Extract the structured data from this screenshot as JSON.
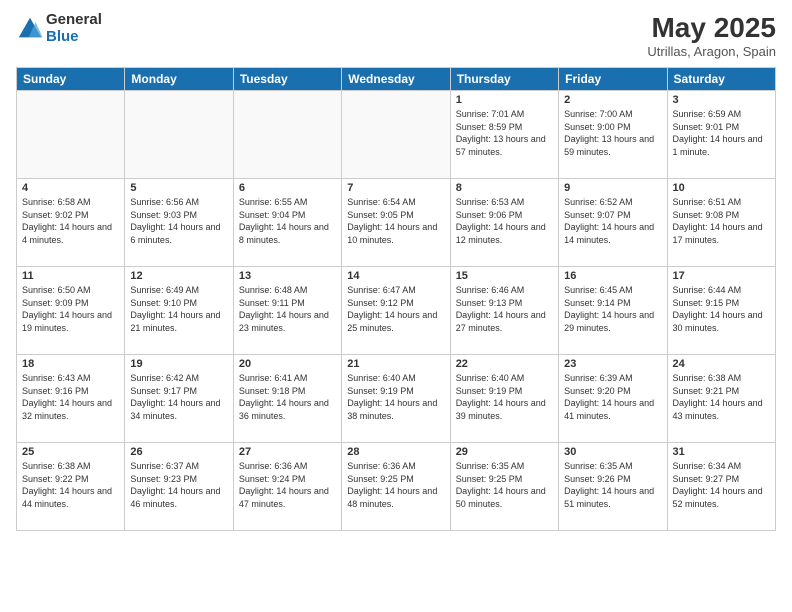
{
  "header": {
    "logo_general": "General",
    "logo_blue": "Blue",
    "month_title": "May 2025",
    "location": "Utrillas, Aragon, Spain"
  },
  "days_of_week": [
    "Sunday",
    "Monday",
    "Tuesday",
    "Wednesday",
    "Thursday",
    "Friday",
    "Saturday"
  ],
  "weeks": [
    [
      {
        "day": "",
        "empty": true
      },
      {
        "day": "",
        "empty": true
      },
      {
        "day": "",
        "empty": true
      },
      {
        "day": "",
        "empty": true
      },
      {
        "day": "1",
        "sunrise": "7:01 AM",
        "sunset": "8:59 PM",
        "daylight": "13 hours and 57 minutes."
      },
      {
        "day": "2",
        "sunrise": "7:00 AM",
        "sunset": "9:00 PM",
        "daylight": "13 hours and 59 minutes."
      },
      {
        "day": "3",
        "sunrise": "6:59 AM",
        "sunset": "9:01 PM",
        "daylight": "14 hours and 1 minute."
      }
    ],
    [
      {
        "day": "4",
        "sunrise": "6:58 AM",
        "sunset": "9:02 PM",
        "daylight": "14 hours and 4 minutes."
      },
      {
        "day": "5",
        "sunrise": "6:56 AM",
        "sunset": "9:03 PM",
        "daylight": "14 hours and 6 minutes."
      },
      {
        "day": "6",
        "sunrise": "6:55 AM",
        "sunset": "9:04 PM",
        "daylight": "14 hours and 8 minutes."
      },
      {
        "day": "7",
        "sunrise": "6:54 AM",
        "sunset": "9:05 PM",
        "daylight": "14 hours and 10 minutes."
      },
      {
        "day": "8",
        "sunrise": "6:53 AM",
        "sunset": "9:06 PM",
        "daylight": "14 hours and 12 minutes."
      },
      {
        "day": "9",
        "sunrise": "6:52 AM",
        "sunset": "9:07 PM",
        "daylight": "14 hours and 14 minutes."
      },
      {
        "day": "10",
        "sunrise": "6:51 AM",
        "sunset": "9:08 PM",
        "daylight": "14 hours and 17 minutes."
      }
    ],
    [
      {
        "day": "11",
        "sunrise": "6:50 AM",
        "sunset": "9:09 PM",
        "daylight": "14 hours and 19 minutes."
      },
      {
        "day": "12",
        "sunrise": "6:49 AM",
        "sunset": "9:10 PM",
        "daylight": "14 hours and 21 minutes."
      },
      {
        "day": "13",
        "sunrise": "6:48 AM",
        "sunset": "9:11 PM",
        "daylight": "14 hours and 23 minutes."
      },
      {
        "day": "14",
        "sunrise": "6:47 AM",
        "sunset": "9:12 PM",
        "daylight": "14 hours and 25 minutes."
      },
      {
        "day": "15",
        "sunrise": "6:46 AM",
        "sunset": "9:13 PM",
        "daylight": "14 hours and 27 minutes."
      },
      {
        "day": "16",
        "sunrise": "6:45 AM",
        "sunset": "9:14 PM",
        "daylight": "14 hours and 29 minutes."
      },
      {
        "day": "17",
        "sunrise": "6:44 AM",
        "sunset": "9:15 PM",
        "daylight": "14 hours and 30 minutes."
      }
    ],
    [
      {
        "day": "18",
        "sunrise": "6:43 AM",
        "sunset": "9:16 PM",
        "daylight": "14 hours and 32 minutes."
      },
      {
        "day": "19",
        "sunrise": "6:42 AM",
        "sunset": "9:17 PM",
        "daylight": "14 hours and 34 minutes."
      },
      {
        "day": "20",
        "sunrise": "6:41 AM",
        "sunset": "9:18 PM",
        "daylight": "14 hours and 36 minutes."
      },
      {
        "day": "21",
        "sunrise": "6:40 AM",
        "sunset": "9:19 PM",
        "daylight": "14 hours and 38 minutes."
      },
      {
        "day": "22",
        "sunrise": "6:40 AM",
        "sunset": "9:19 PM",
        "daylight": "14 hours and 39 minutes."
      },
      {
        "day": "23",
        "sunrise": "6:39 AM",
        "sunset": "9:20 PM",
        "daylight": "14 hours and 41 minutes."
      },
      {
        "day": "24",
        "sunrise": "6:38 AM",
        "sunset": "9:21 PM",
        "daylight": "14 hours and 43 minutes."
      }
    ],
    [
      {
        "day": "25",
        "sunrise": "6:38 AM",
        "sunset": "9:22 PM",
        "daylight": "14 hours and 44 minutes."
      },
      {
        "day": "26",
        "sunrise": "6:37 AM",
        "sunset": "9:23 PM",
        "daylight": "14 hours and 46 minutes."
      },
      {
        "day": "27",
        "sunrise": "6:36 AM",
        "sunset": "9:24 PM",
        "daylight": "14 hours and 47 minutes."
      },
      {
        "day": "28",
        "sunrise": "6:36 AM",
        "sunset": "9:25 PM",
        "daylight": "14 hours and 48 minutes."
      },
      {
        "day": "29",
        "sunrise": "6:35 AM",
        "sunset": "9:25 PM",
        "daylight": "14 hours and 50 minutes."
      },
      {
        "day": "30",
        "sunrise": "6:35 AM",
        "sunset": "9:26 PM",
        "daylight": "14 hours and 51 minutes."
      },
      {
        "day": "31",
        "sunrise": "6:34 AM",
        "sunset": "9:27 PM",
        "daylight": "14 hours and 52 minutes."
      }
    ]
  ]
}
